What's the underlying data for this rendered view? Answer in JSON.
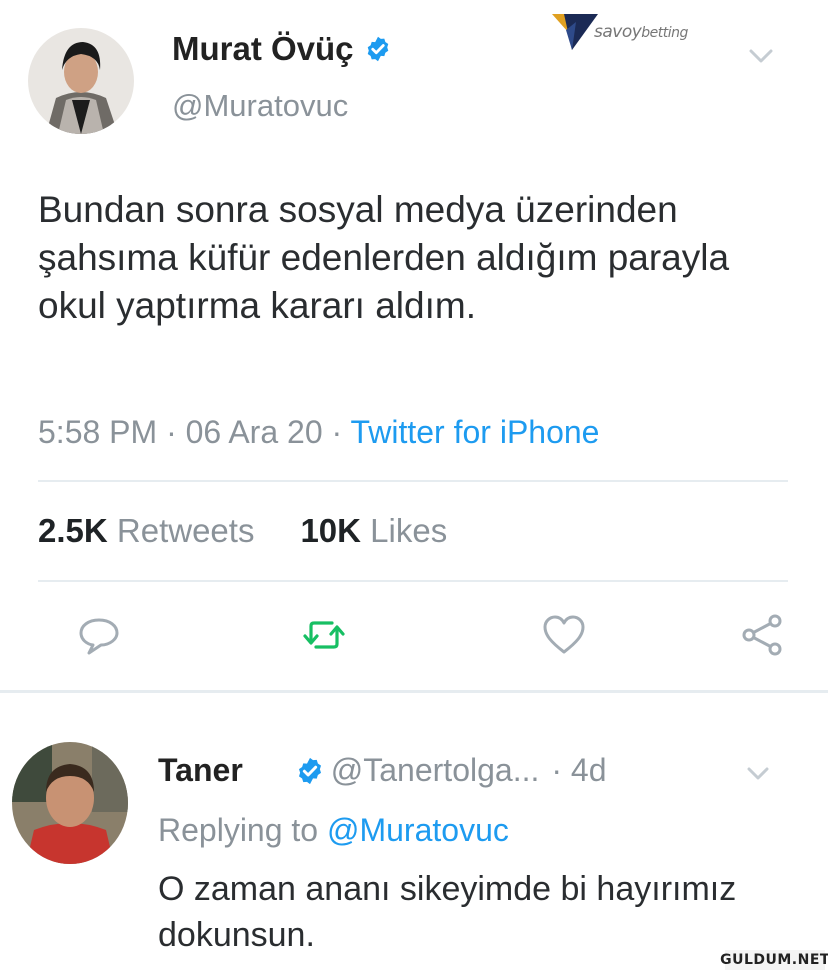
{
  "watermark": {
    "brand_main": "savoy",
    "brand_sub": "betting",
    "icon": "savoy-logo-icon"
  },
  "tweet": {
    "author_name": "Murat Övüç",
    "handle": "@Muratovuc",
    "verified": true,
    "text": "Bundan sonra sosyal medya üzerinden şahsıma küfür edenlerden aldığım parayla okul yaptırma kararı aldım.",
    "time": "5:58 PM",
    "date": "06 Ara 20",
    "source": "Twitter for iPhone",
    "retweets_count": "2.5K",
    "retweets_label": "Retweets",
    "likes_count": "10K",
    "likes_label": "Likes",
    "actions": [
      "reply-icon",
      "retweet-icon",
      "like-icon",
      "share-icon"
    ]
  },
  "reply": {
    "author_name": "Taner",
    "handle": "@Tanertolga...",
    "age": "· 4d",
    "replying_prefix": "Replying to",
    "replying_to": "@Muratovuc",
    "text": "O zaman ananı sikeyimde bi hayırımız dokunsun."
  },
  "footer": {
    "site": "GULDUM.NET"
  },
  "colors": {
    "accent": "#1d9bf0",
    "retweet": "#17bf63",
    "muted": "#8a9299",
    "text": "#14171a"
  }
}
